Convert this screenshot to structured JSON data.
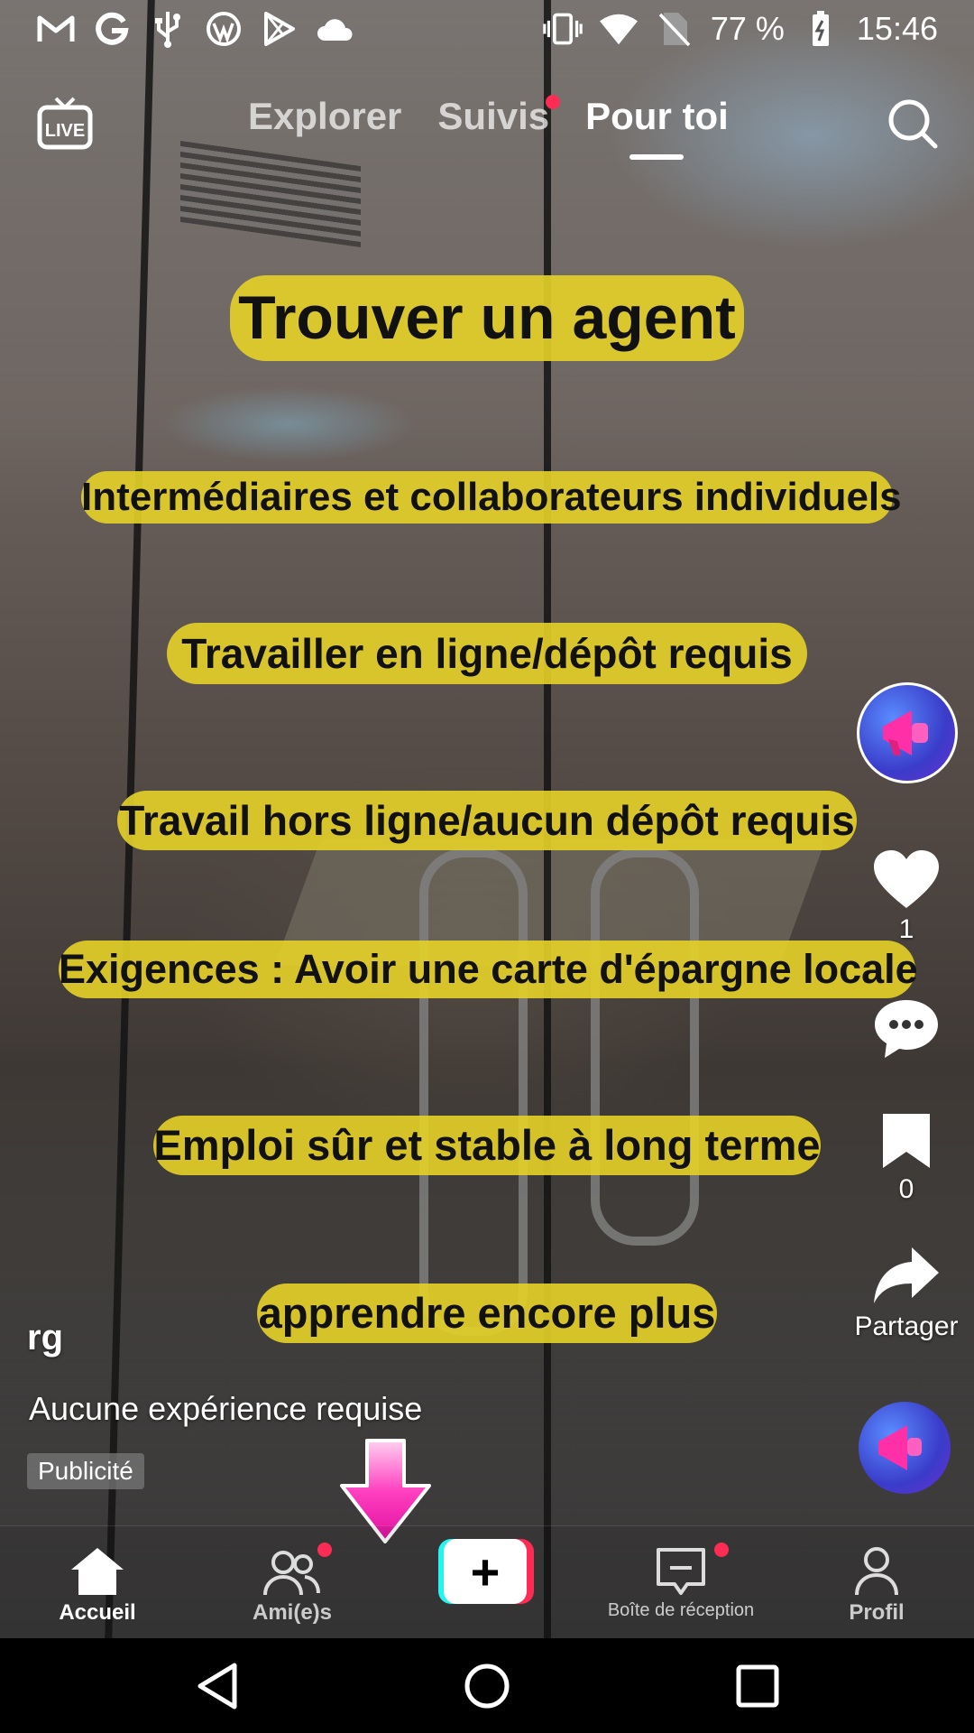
{
  "status_bar": {
    "battery": "77 %",
    "time": "15:46"
  },
  "top_nav": {
    "tabs": [
      {
        "label": "Explorer",
        "active": false
      },
      {
        "label": "Suivis",
        "active": false,
        "has_dot": true
      },
      {
        "label": "Pour toi",
        "active": true
      }
    ]
  },
  "video": {
    "overlay_title": "Trouver un agent",
    "overlay_lines": [
      "Intermédiaires et collaborateurs individuels",
      "Travailler en ligne/dépôt requis",
      "Travail hors ligne/aucun dépôt requis",
      "Exigences : Avoir une carte d'épargne locale",
      "Emploi sûr et stable à long terme",
      "apprendre encore plus"
    ]
  },
  "actions": {
    "likes": "1",
    "saves": "0",
    "share_label": "Partager"
  },
  "caption": {
    "username": "rg",
    "description": "Aucune expérience requise",
    "ad_badge": "Publicité"
  },
  "bottom_tabs": {
    "home": "Accueil",
    "friends": "Ami(e)s",
    "inbox": "Boîte de réception",
    "profile": "Profil"
  },
  "colors": {
    "accent_red": "#fe2c55",
    "accent_cyan": "#25f4ee",
    "pill_yellow": "#e6d228"
  }
}
